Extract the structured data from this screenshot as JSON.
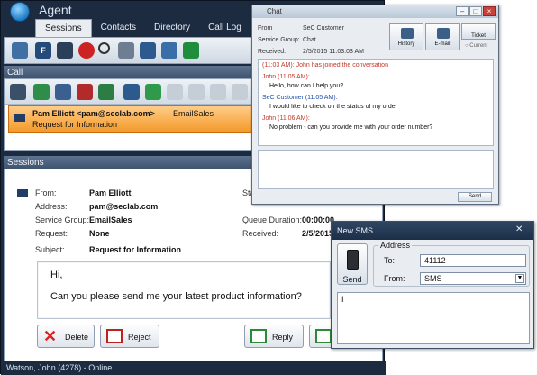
{
  "agent": {
    "title": "Agent",
    "menu": [
      "Sessions",
      "Contacts",
      "Directory",
      "Call Log"
    ],
    "call_header": "Call",
    "call_item": {
      "caller": "Pam Elliott <pam@seclab.com>",
      "queue": "EmailSales",
      "subject": "Request for Information"
    },
    "sessions_header": "Sessions",
    "session": {
      "from_label": "From:",
      "from_value": "Pam Elliott",
      "address_label": "Address:",
      "address_value": "pam@seclab.com",
      "service_group_label": "Service Group:",
      "service_group_value": "EmailSales",
      "request_label": "Request:",
      "request_value": "None",
      "subject_label": "Subject:",
      "subject_value": "Request for Information",
      "state_label": "Sta",
      "queue_duration_label": "Queue Duration:",
      "queue_duration_value": "00:00:00",
      "received_label": "Received:",
      "received_value": "2/5/2015"
    },
    "message": {
      "greeting": "Hi,",
      "body": "Can you please send me your latest product information?"
    },
    "buttons": {
      "delete": "Delete",
      "reject": "Reject",
      "reply": "Reply"
    },
    "status": "Watson, John (4278) - Online"
  },
  "chat": {
    "title": "Chat",
    "info": {
      "from_label": "From",
      "from_value": "SeC Customer",
      "group_label": "Service Group:",
      "group_value": "Chat",
      "received_label": "Received:",
      "received_value": "2/5/2015 11:03:03 AM"
    },
    "buttons": {
      "history": "History",
      "email": "E-mail",
      "ticket": "Ticket",
      "current": "Current"
    },
    "log": [
      {
        "text": "(11:03 AM): John has joined the conversation",
        "color": "#c0392b"
      },
      {
        "text": "John (11:05 AM):",
        "color": "#c0392b"
      },
      {
        "text": "Hello, how can I help you?",
        "color": "#222222"
      },
      {
        "text": "SeC Customer (11:05 AM):",
        "color": "#1f4fa8"
      },
      {
        "text": "I would like to check on the status of my order",
        "color": "#222222"
      },
      {
        "text": "John (11:06 AM):",
        "color": "#c0392b"
      },
      {
        "text": "No problem - can you provide me with your order number?",
        "color": "#222222"
      }
    ],
    "send": "Send"
  },
  "sms": {
    "title": "New SMS",
    "send": "Send",
    "address_legend": "Address",
    "to_label": "To:",
    "to_value": "41112",
    "from_label": "From:",
    "from_value": "SMS",
    "body": "I"
  }
}
